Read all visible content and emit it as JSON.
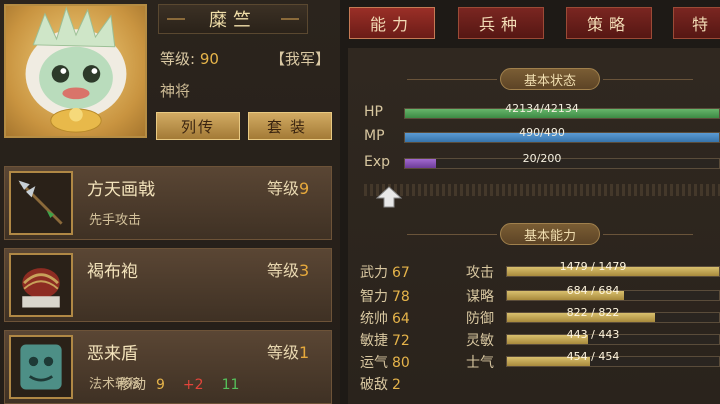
{
  "character": {
    "name": "糜竺",
    "level_label": "等级:",
    "level": "90",
    "faction": "【我军】",
    "rank": "神将",
    "btn_bio": "列传",
    "btn_set": "套装"
  },
  "equipment": [
    {
      "name": "方天画戟",
      "level_label": "等级",
      "level": "9",
      "skill": "先手攻击",
      "icon": "halberd-icon"
    },
    {
      "name": "褐布袍",
      "level_label": "等级",
      "level": "3",
      "skill": "",
      "icon": "robe-icon"
    },
    {
      "name": "恶来盾",
      "level_label": "等级",
      "level": "1",
      "skill": "法术转移",
      "icon": "shield-icon"
    }
  ],
  "tabs": [
    "能力",
    "兵种",
    "策略",
    "特"
  ],
  "status": {
    "title": "基本状态",
    "hp": {
      "label": "HP",
      "text": "42134/42134",
      "fraction": 1.0
    },
    "mp": {
      "label": "MP",
      "text": "490/490",
      "fraction": 1.0
    },
    "exp": {
      "label": "Exp",
      "text": "20/200",
      "fraction": 0.1
    }
  },
  "abilities": {
    "title": "基本能力",
    "stats": [
      {
        "label": "武力",
        "value": "67"
      },
      {
        "label": "智力",
        "value": "78"
      },
      {
        "label": "统帅",
        "value": "64"
      },
      {
        "label": "敏捷",
        "value": "72"
      },
      {
        "label": "运气",
        "value": "80"
      },
      {
        "label": "破敌",
        "value": "2"
      }
    ],
    "bars": [
      {
        "label": "攻击",
        "text": "1479 / 1479",
        "fraction": 1.0
      },
      {
        "label": "谋略",
        "text": "684 / 684",
        "fraction": 0.55
      },
      {
        "label": "防御",
        "text": "822 / 822",
        "fraction": 0.7
      },
      {
        "label": "灵敏",
        "text": "443 / 443",
        "fraction": 0.38
      },
      {
        "label": "士气",
        "text": "454 / 454",
        "fraction": 0.39
      }
    ],
    "move": {
      "label": "移动",
      "base": "9",
      "bonus": "+2",
      "total": "11"
    }
  },
  "colors": {
    "hp": "#4c9e52",
    "mp": "#4a8ac2",
    "exp": "#8a52b8",
    "accent_gold": "#e6b44a"
  }
}
